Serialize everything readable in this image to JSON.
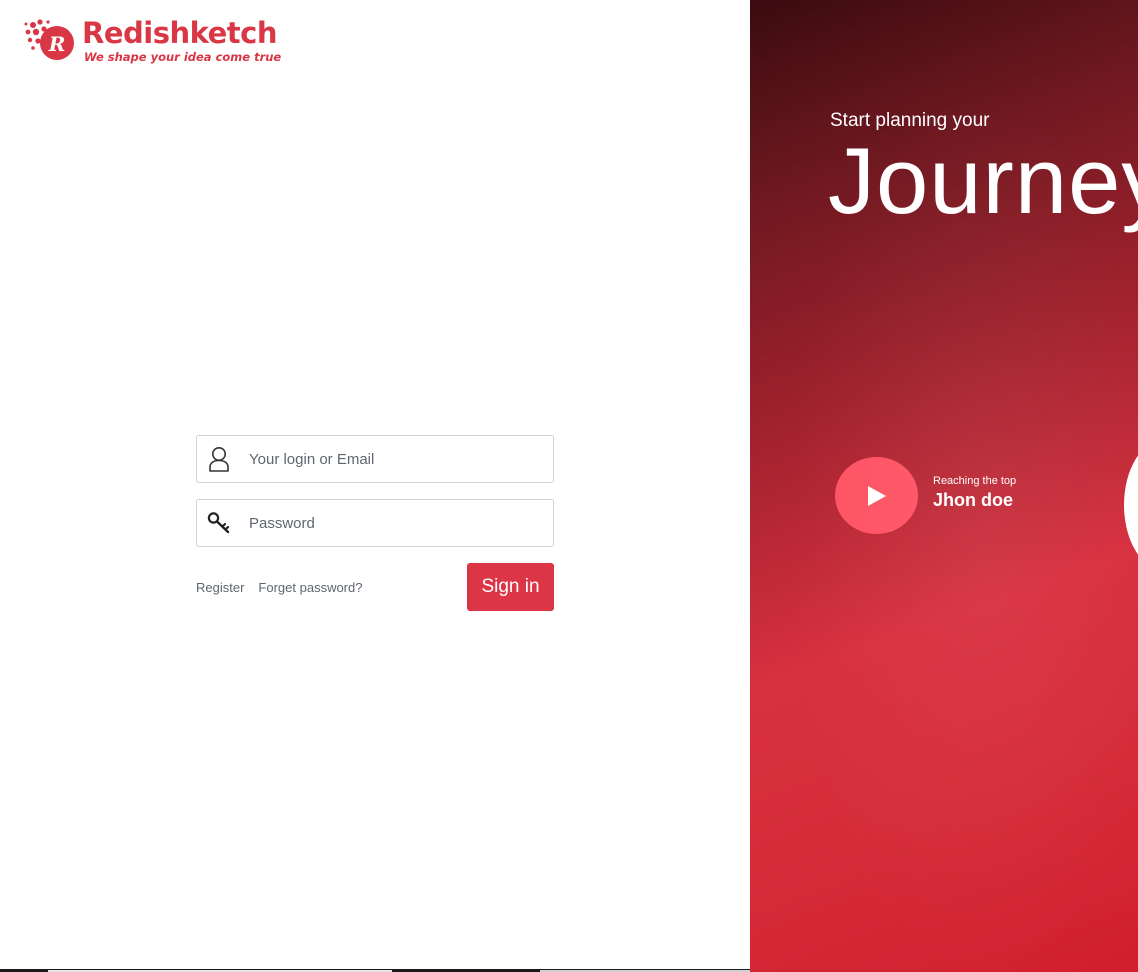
{
  "brand": {
    "name": "Redishketch",
    "tagline": "We shape your idea come true",
    "logo_letter": "R",
    "color": "#d93646"
  },
  "login": {
    "username_placeholder": "Your login or Email",
    "username_icon": "user-icon",
    "password_placeholder": "Password",
    "password_icon": "key-icon",
    "register_label": "Register",
    "forgot_label": "Forget password?",
    "signin_label": "Sign in",
    "accent": "#dc3545"
  },
  "hero": {
    "subtitle": "Start planning your",
    "title": "Journey",
    "video": {
      "kicker": "Reaching the top",
      "name": "Jhon doe",
      "play_icon": "play-icon",
      "button_color": "#ff5364"
    }
  }
}
